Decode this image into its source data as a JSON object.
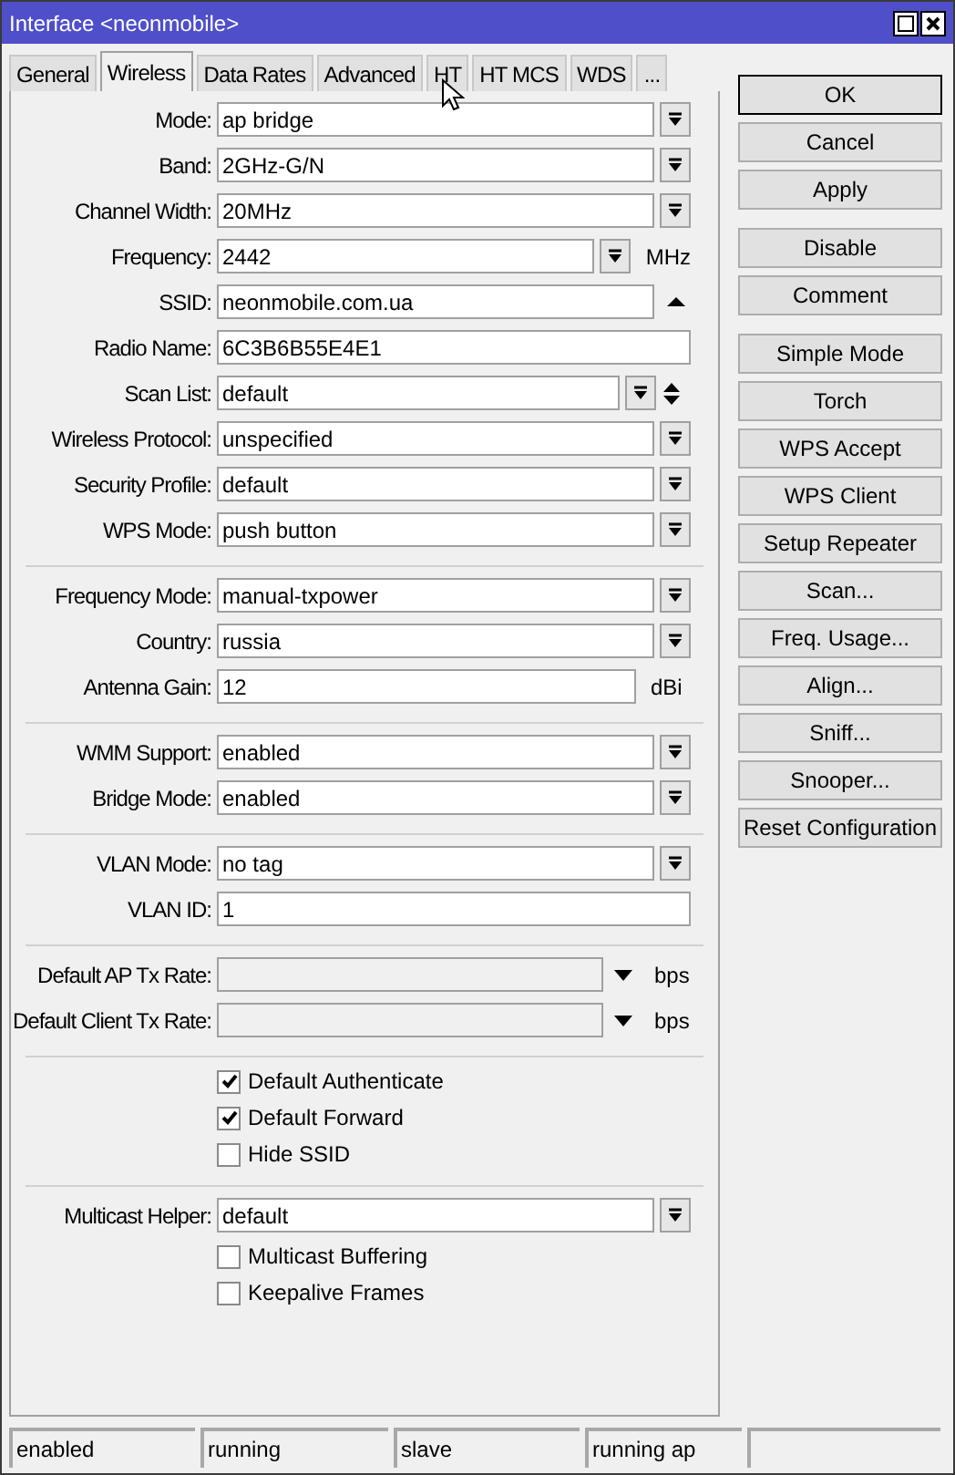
{
  "window": {
    "title": "Interface <neonmobile>"
  },
  "tabs": [
    {
      "label": "General",
      "selected": false
    },
    {
      "label": "Wireless",
      "selected": true
    },
    {
      "label": "Data Rates",
      "selected": false
    },
    {
      "label": "Advanced",
      "selected": false
    },
    {
      "label": "HT",
      "selected": false
    },
    {
      "label": "HT MCS",
      "selected": false
    },
    {
      "label": "WDS",
      "selected": false
    },
    {
      "label": "...",
      "selected": false
    }
  ],
  "sections": [
    {
      "rows": [
        {
          "kind": "select",
          "label": "Mode:",
          "value": "ap bridge"
        },
        {
          "kind": "select",
          "label": "Band:",
          "value": "2GHz-G/N"
        },
        {
          "kind": "select",
          "label": "Channel Width:",
          "value": "20MHz"
        },
        {
          "kind": "select_unit",
          "label": "Frequency:",
          "value": "2442",
          "unit": "MHz"
        },
        {
          "kind": "collapse",
          "label": "SSID:",
          "value": "neonmobile.com.ua"
        },
        {
          "kind": "text",
          "label": "Radio Name:",
          "value": "6C3B6B55E4E1"
        },
        {
          "kind": "select_multi",
          "label": "Scan List:",
          "value": "default"
        },
        {
          "kind": "select",
          "label": "Wireless Protocol:",
          "value": "unspecified"
        },
        {
          "kind": "select",
          "label": "Security Profile:",
          "value": "default"
        },
        {
          "kind": "select",
          "label": "WPS Mode:",
          "value": "push button"
        }
      ]
    },
    {
      "rows": [
        {
          "kind": "select",
          "label": "Frequency Mode:",
          "value": "manual-txpower"
        },
        {
          "kind": "select",
          "label": "Country:",
          "value": "russia"
        },
        {
          "kind": "text_unit",
          "label": "Antenna Gain:",
          "value": "12",
          "unit": "dBi"
        }
      ]
    },
    {
      "rows": [
        {
          "kind": "select",
          "label": "WMM Support:",
          "value": "enabled"
        },
        {
          "kind": "select",
          "label": "Bridge Mode:",
          "value": "enabled"
        }
      ]
    },
    {
      "rows": [
        {
          "kind": "select",
          "label": "VLAN Mode:",
          "value": "no tag"
        },
        {
          "kind": "text",
          "label": "VLAN ID:",
          "value": "1"
        }
      ]
    },
    {
      "rows": [
        {
          "kind": "rate",
          "label": "Default AP Tx Rate:",
          "unit": "bps"
        },
        {
          "kind": "rate",
          "label": "Default Client Tx Rate:",
          "unit": "bps"
        }
      ]
    },
    {
      "rows": [
        {
          "kind": "checkbox",
          "label": "Default Authenticate",
          "checked": true
        },
        {
          "kind": "checkbox",
          "label": "Default Forward",
          "checked": true
        },
        {
          "kind": "checkbox",
          "label": "Hide SSID",
          "checked": false
        }
      ]
    },
    {
      "rows": [
        {
          "kind": "select",
          "label": "Multicast Helper:",
          "value": "default"
        },
        {
          "kind": "checkbox",
          "label": "Multicast Buffering",
          "checked": false
        },
        {
          "kind": "checkbox",
          "label": "Keepalive Frames",
          "checked": false
        }
      ]
    }
  ],
  "button_groups": [
    {
      "buttons": [
        {
          "label": "OK",
          "default": true
        },
        {
          "label": "Cancel",
          "default": false
        },
        {
          "label": "Apply",
          "default": false
        }
      ]
    },
    {
      "buttons": [
        {
          "label": "Disable",
          "default": false
        },
        {
          "label": "Comment",
          "default": false
        }
      ]
    },
    {
      "buttons": [
        {
          "label": "Simple Mode",
          "default": false
        },
        {
          "label": "Torch",
          "default": false
        },
        {
          "label": "WPS Accept",
          "default": false
        },
        {
          "label": "WPS Client",
          "default": false
        },
        {
          "label": "Setup Repeater",
          "default": false
        },
        {
          "label": "Scan...",
          "default": false
        },
        {
          "label": "Freq. Usage...",
          "default": false
        },
        {
          "label": "Align...",
          "default": false
        },
        {
          "label": "Sniff...",
          "default": false
        },
        {
          "label": "Snooper...",
          "default": false
        },
        {
          "label": "Reset Configuration",
          "default": false
        }
      ]
    }
  ],
  "status_bar": [
    "enabled",
    "running",
    "slave",
    "running ap"
  ]
}
